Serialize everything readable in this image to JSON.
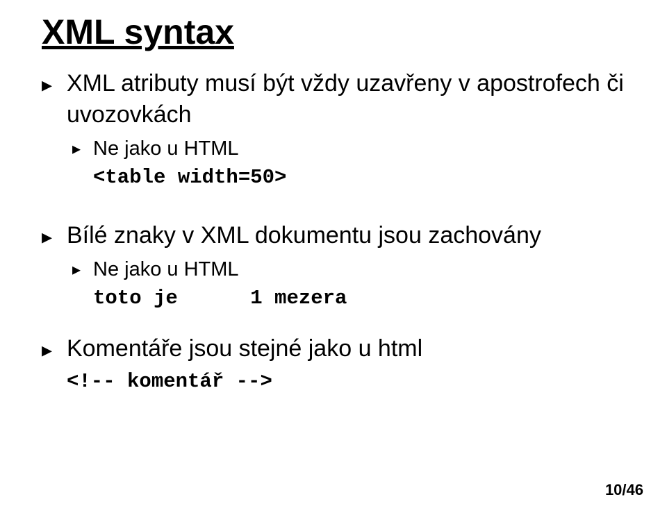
{
  "title": "XML syntax",
  "bullets": {
    "b1": {
      "text": "XML atributy musí být vždy uzavřeny v apostrofech či uvozovkách",
      "sub": {
        "text": "Ne jako u HTML"
      },
      "code": "<table width=50>"
    },
    "b2": {
      "text": "Bílé znaky v XML dokumentu jsou zachovány",
      "sub": {
        "text": "Ne jako u HTML"
      },
      "code": "toto je      1 mezera"
    },
    "b3": {
      "text": "Komentáře jsou stejné jako u html",
      "code": "<!-- komentář -->"
    }
  },
  "page": "10/46",
  "glyphs": {
    "triangle": "▸"
  }
}
